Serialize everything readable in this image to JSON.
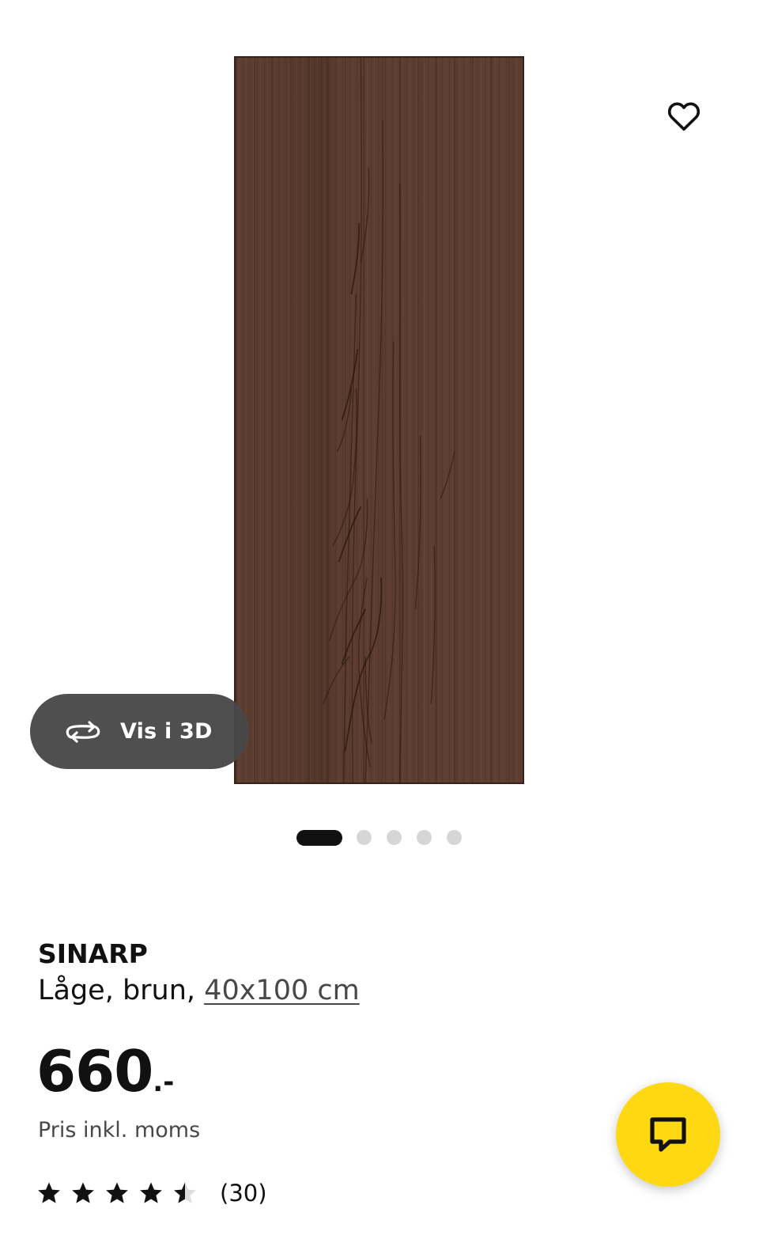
{
  "gallery": {
    "image_alt": "SINARP Låge, brun, 40x100 cm",
    "view_3d_label": "Vis i 3D",
    "active_slide": 1,
    "slide_count": 5
  },
  "product": {
    "name": "SINARP",
    "description_prefix": "Låge, brun, ",
    "size_link": "40x100 cm",
    "price_amount": "660",
    "price_suffix": ".-",
    "price_note": "Pris inkl. moms",
    "rating_value": 4.5,
    "rating_max": 5,
    "review_count": "(30)"
  },
  "icons": {
    "favorite": "heart-outline-icon",
    "view_3d": "rotate-360-icon",
    "chat": "chat-bubble-icon",
    "star": "star-icon"
  },
  "colors": {
    "chat_button": "#fdd813",
    "wood": "#5e3e30",
    "pill": "#484848",
    "dot_active": "#111111",
    "dot_inactive": "#d6d6d6"
  }
}
